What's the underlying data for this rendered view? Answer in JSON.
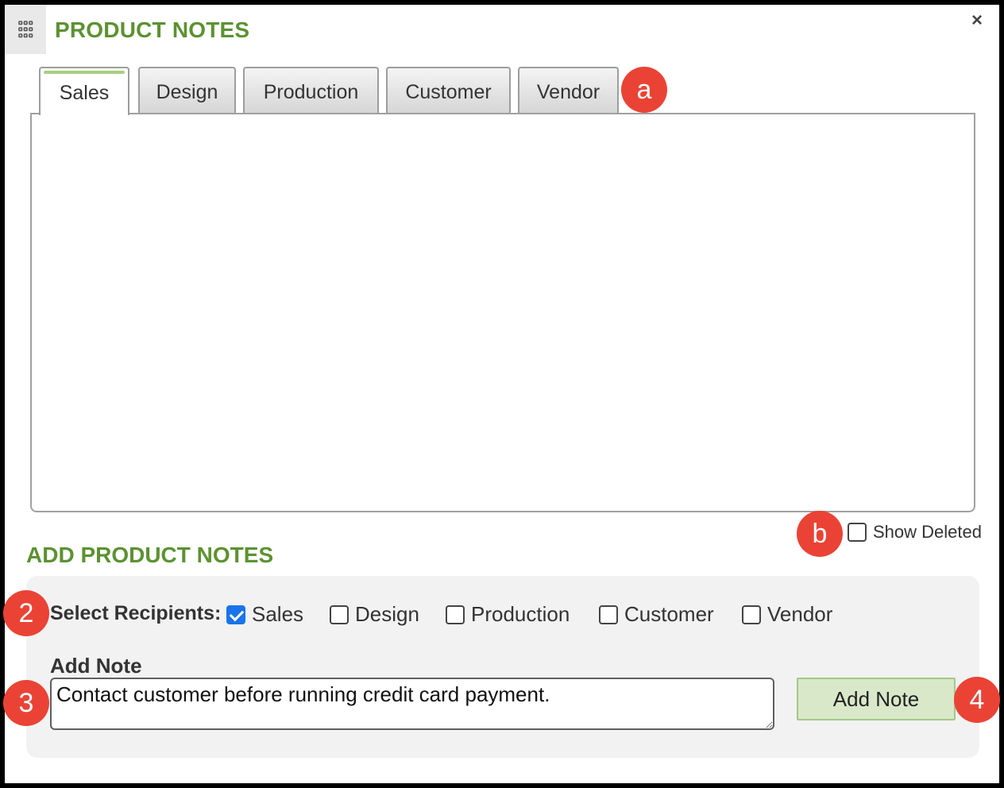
{
  "dialog": {
    "title": "PRODUCT NOTES",
    "close_glyph": "×",
    "grip_icon": "grid-dots-icon"
  },
  "tabs": [
    {
      "label": "Sales",
      "active": true
    },
    {
      "label": "Design",
      "active": false
    },
    {
      "label": "Production",
      "active": false
    },
    {
      "label": "Customer",
      "active": false
    },
    {
      "label": "Vendor",
      "active": false
    }
  ],
  "show_deleted": {
    "label": "Show Deleted",
    "checked": false
  },
  "add_section": {
    "heading": "ADD PRODUCT NOTES",
    "recipients_label": "Select Recipients:",
    "recipients": [
      {
        "label": "Sales",
        "checked": true
      },
      {
        "label": "Design",
        "checked": false
      },
      {
        "label": "Production",
        "checked": false
      },
      {
        "label": "Customer",
        "checked": false
      },
      {
        "label": "Vendor",
        "checked": false
      }
    ],
    "note_label": "Add Note",
    "note_value": "Contact customer before running credit card payment.",
    "add_button": "Add Note"
  },
  "callouts": {
    "a": "a",
    "b": "b",
    "two": "2",
    "three": "3",
    "four": "4"
  },
  "colors": {
    "accent_green": "#5c9231",
    "callout_red": "#ea4335",
    "checkbox_blue": "#1a73e8",
    "button_green": "#d9e8c9"
  }
}
